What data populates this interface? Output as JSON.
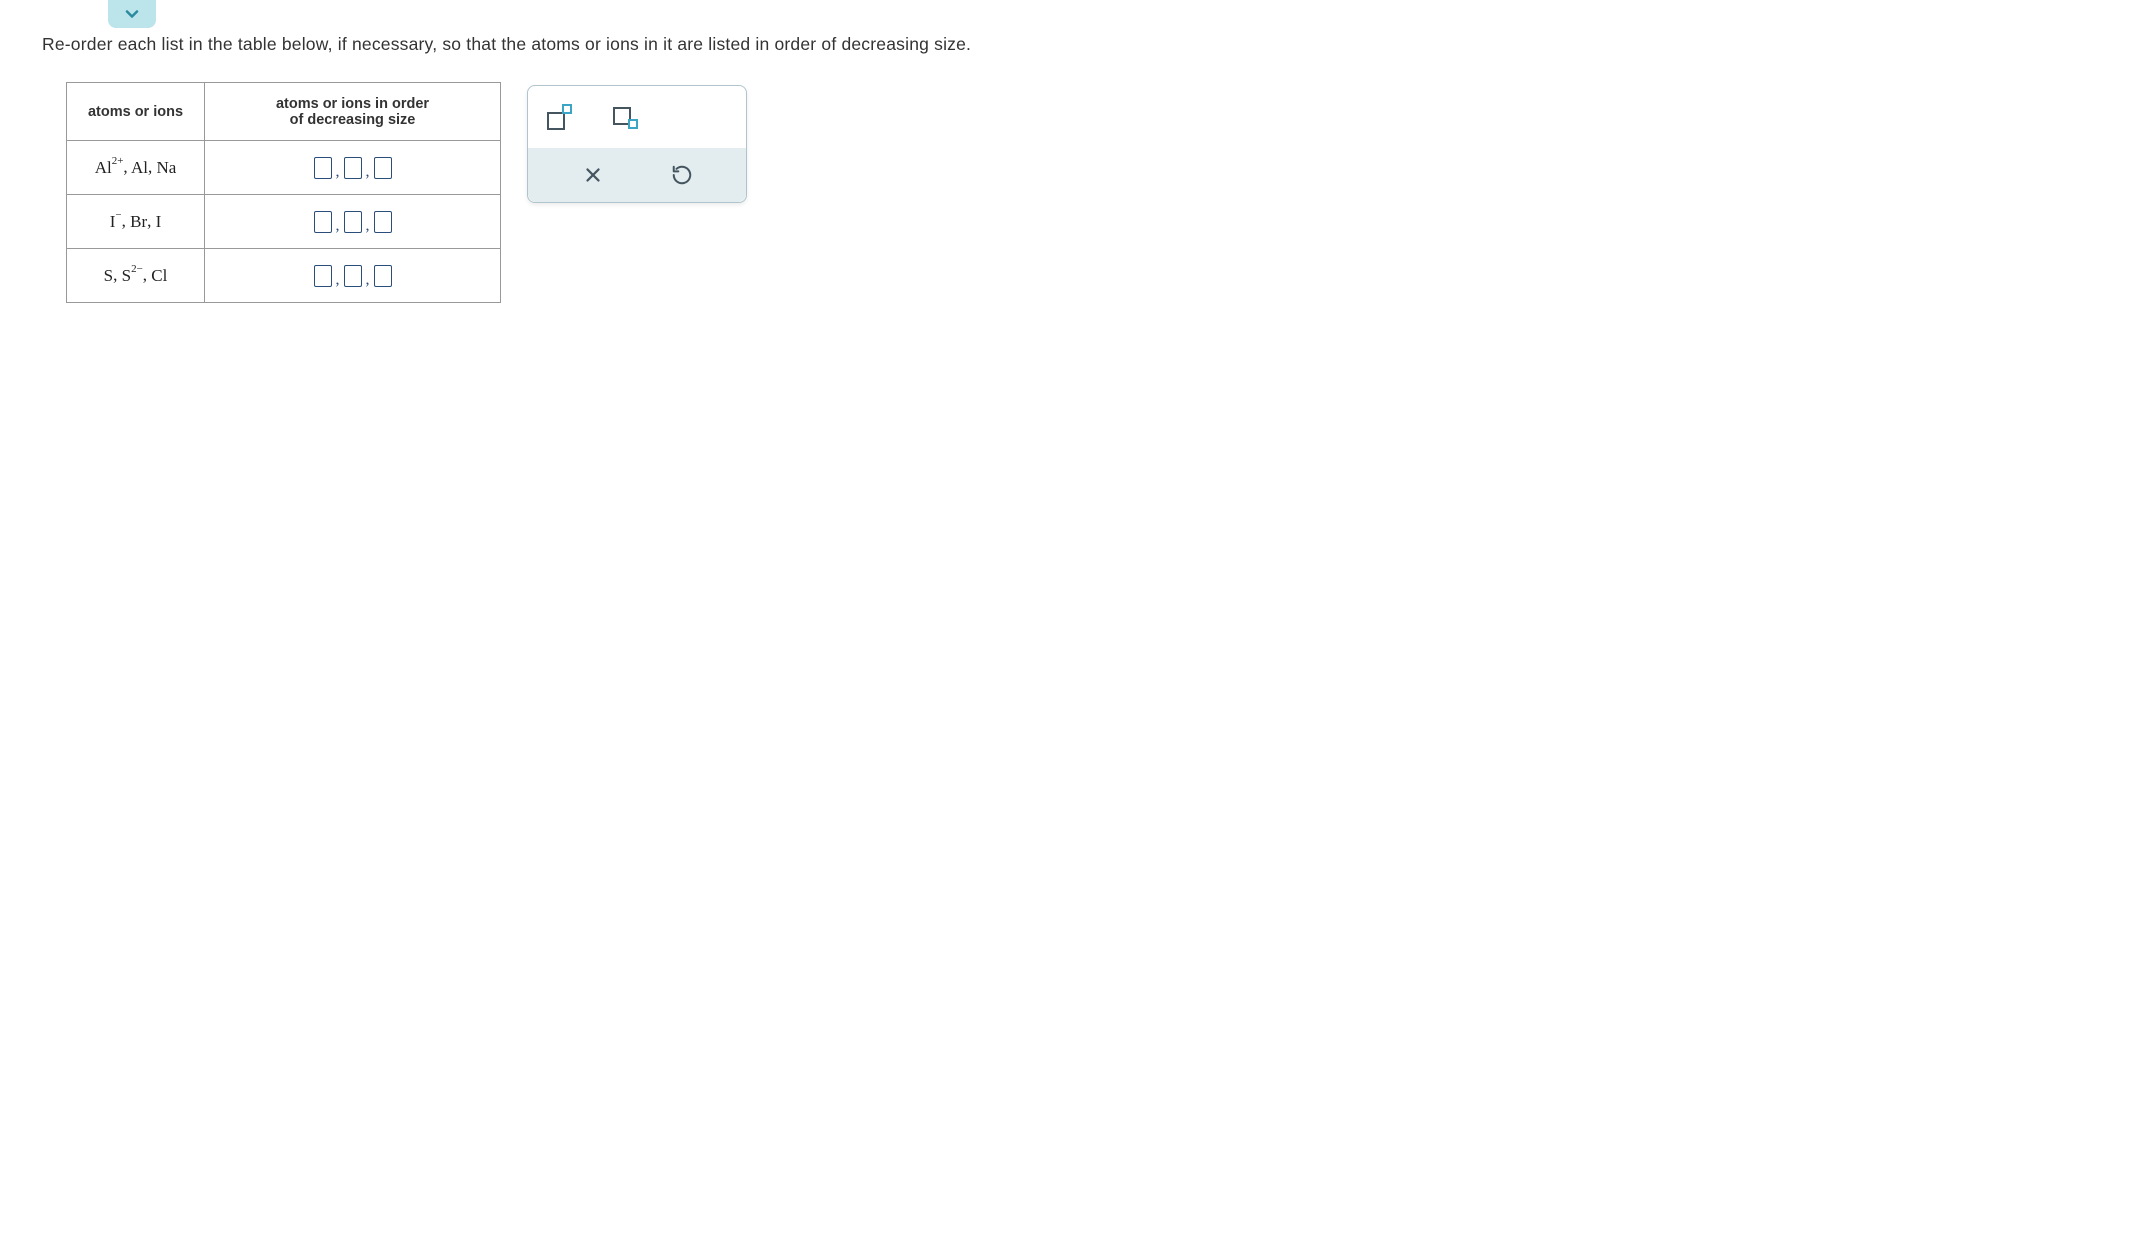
{
  "instruction": "Re-order each list in the table below, if necessary, so that the atoms or ions in it are listed in order of decreasing size.",
  "table": {
    "header_col1": "atoms or ions",
    "header_col2_line1": "atoms or ions in order",
    "header_col2_line2": "of decreasing size",
    "rows": [
      {
        "species": [
          {
            "base": "Al",
            "sup": "2+"
          },
          {
            "base": "Al",
            "sup": ""
          },
          {
            "base": "Na",
            "sup": ""
          }
        ]
      },
      {
        "species": [
          {
            "base": "I",
            "sup": "−"
          },
          {
            "base": "Br",
            "sup": ""
          },
          {
            "base": "I",
            "sup": ""
          }
        ]
      },
      {
        "species": [
          {
            "base": "S",
            "sup": ""
          },
          {
            "base": "S",
            "sup": "2−"
          },
          {
            "base": "Cl",
            "sup": ""
          }
        ]
      }
    ]
  },
  "separator": ",",
  "tool_icons": {
    "superscript": "superscript-tool",
    "subscript": "subscript-tool",
    "clear": "clear",
    "undo": "undo"
  }
}
